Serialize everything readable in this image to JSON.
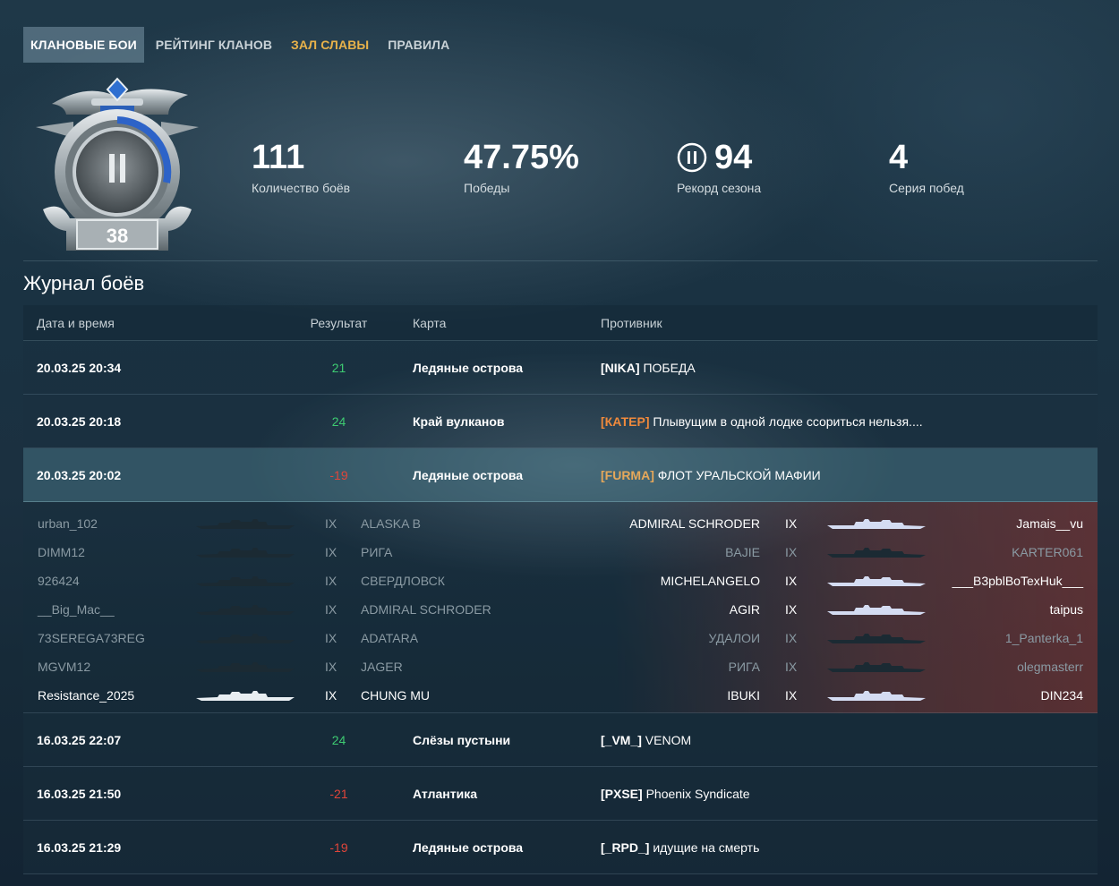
{
  "nav": {
    "items": [
      {
        "label": "КЛАНОВЫЕ БОИ",
        "state": "active"
      },
      {
        "label": "РЕЙТИНГ КЛАНОВ",
        "state": "normal"
      },
      {
        "label": "ЗАЛ СЛАВЫ",
        "state": "highlight"
      },
      {
        "label": "ПРАВИЛА",
        "state": "normal"
      }
    ]
  },
  "emblem": {
    "league": "II",
    "rating": "38"
  },
  "stats": {
    "battles": {
      "value": "111",
      "label": "Количество боёв"
    },
    "wins": {
      "value": "47.75%",
      "label": "Победы"
    },
    "record": {
      "value": "94",
      "label": "Рекорд сезона",
      "icon": "league-ii-icon"
    },
    "streak": {
      "value": "4",
      "label": "Серия побед"
    }
  },
  "journal": {
    "title": "Журнал боёв",
    "headers": {
      "date": "Дата и время",
      "result": "Результат",
      "map": "Карта",
      "opponent": "Противник"
    },
    "rows": [
      {
        "date": "20.03.25 20:34",
        "result": "21",
        "outcome": "win",
        "map": "Ледяные острова",
        "tag": "[NIKA]",
        "tag_color": "#ffffff",
        "clan": "ПОБЕДА"
      },
      {
        "date": "20.03.25 20:18",
        "result": "24",
        "outcome": "win",
        "map": "Край вулканов",
        "tag": "[КАТЕР]",
        "tag_color": "#f08a3c",
        "clan": "Плывущим в одной лодке ссориться нельзя...."
      },
      {
        "date": "20.03.25 20:02",
        "result": "-19",
        "outcome": "loss",
        "map": "Ледяные острова",
        "tag": "[FURMA]",
        "tag_color": "#e6a85a",
        "clan": "ФЛОТ УРАЛЬСКОЙ МАФИИ",
        "expanded": true
      },
      {
        "date": "16.03.25 22:07",
        "result": "24",
        "outcome": "win",
        "map": "Слёзы пустыни",
        "tag": "[_VM_]",
        "tag_color": "#ffffff",
        "clan": "VENOM"
      },
      {
        "date": "16.03.25 21:50",
        "result": "-21",
        "outcome": "loss",
        "map": "Атлантика",
        "tag": "[PXSE]",
        "tag_color": "#ffffff",
        "clan": "Phoenix Syndicate"
      },
      {
        "date": "16.03.25 21:29",
        "result": "-19",
        "outcome": "loss",
        "map": "Ледяные острова",
        "tag": "[_RPD_]",
        "tag_color": "#ffffff",
        "clan": "идущие на смерть"
      }
    ],
    "details": {
      "own_team": [
        {
          "player": "urban_102",
          "tier": "IX",
          "ship": "ALASKA B",
          "alive": false
        },
        {
          "player": "DIMM12",
          "tier": "IX",
          "ship": "РИГА",
          "alive": false
        },
        {
          "player": "926424",
          "tier": "IX",
          "ship": "СВЕРДЛОВСК",
          "alive": false
        },
        {
          "player": "__Big_Mac__",
          "tier": "IX",
          "ship": "ADMIRAL SCHRODER",
          "alive": false
        },
        {
          "player": "73SEREGA73REG",
          "tier": "IX",
          "ship": "ADATARA",
          "alive": false
        },
        {
          "player": "MGVM12",
          "tier": "IX",
          "ship": "JAGER",
          "alive": false
        },
        {
          "player": "Resistance_2025",
          "tier": "IX",
          "ship": "CHUNG MU",
          "alive": true
        }
      ],
      "enemy_team": [
        {
          "player": "Jamais__vu",
          "tier": "IX",
          "ship": "ADMIRAL SCHRODER",
          "alive": true
        },
        {
          "player": "KARTER061",
          "tier": "IX",
          "ship": "BAJIE",
          "alive": false
        },
        {
          "player": "___B3pblBoTexHuk___",
          "tier": "IX",
          "ship": "MICHELANGELO",
          "alive": true
        },
        {
          "player": "taipus",
          "tier": "IX",
          "ship": "AGIR",
          "alive": true
        },
        {
          "player": "1_Panterka_1",
          "tier": "IX",
          "ship": "УДАЛОИ",
          "alive": false
        },
        {
          "player": "olegmasterr",
          "tier": "IX",
          "ship": "РИГА",
          "alive": false
        },
        {
          "player": "DIN234",
          "tier": "IX",
          "ship": "IBUKI",
          "alive": true
        }
      ]
    }
  }
}
